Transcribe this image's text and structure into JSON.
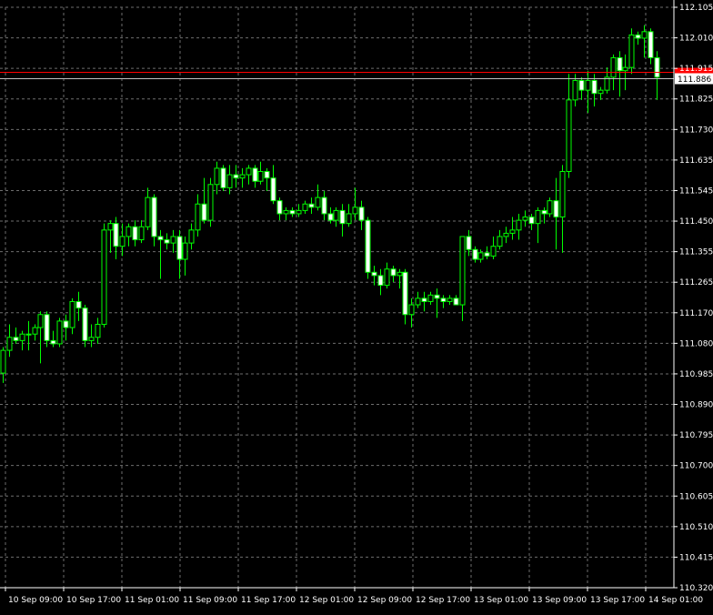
{
  "chart_data": {
    "type": "candlestick",
    "title": "",
    "xlabel": "",
    "ylabel": "",
    "ylim": [
      110.32,
      112.105
    ],
    "y_ticks": [
      "112.105",
      "112.010",
      "111.915",
      "111.825",
      "111.730",
      "111.635",
      "111.545",
      "111.450",
      "111.355",
      "111.265",
      "111.170",
      "111.080",
      "110.985",
      "110.890",
      "110.795",
      "110.700",
      "110.605",
      "110.510",
      "110.415",
      "110.320"
    ],
    "x_ticks": [
      "10 Sep 09:00",
      "10 Sep 17:00",
      "11 Sep 01:00",
      "11 Sep 09:00",
      "11 Sep 17:00",
      "12 Sep 01:00",
      "12 Sep 09:00",
      "12 Sep 17:00",
      "13 Sep 01:00",
      "13 Sep 09:00",
      "13 Sep 17:00",
      "14 Sep 01:00"
    ],
    "grid": true,
    "colors": {
      "background": "#000000",
      "grid": "#6e6e6e",
      "bull_body": "#000000",
      "bear_body": "#ffffff",
      "wick": "#00ff00",
      "axis": "#ffffff",
      "bid_line": "#ff0000",
      "ask_line": "#c0c0c0"
    },
    "bid_price": 111.905,
    "ask_price": 111.886,
    "bid_label": "",
    "ask_label": "111.886",
    "candles": [
      {
        "o": 110.98,
        "h": 111.06,
        "l": 110.95,
        "c": 111.05
      },
      {
        "o": 111.05,
        "h": 111.13,
        "l": 111.03,
        "c": 111.09
      },
      {
        "o": 111.09,
        "h": 111.12,
        "l": 111.07,
        "c": 111.08
      },
      {
        "o": 111.08,
        "h": 111.11,
        "l": 111.05,
        "c": 111.1
      },
      {
        "o": 111.1,
        "h": 111.14,
        "l": 111.05,
        "c": 111.1
      },
      {
        "o": 111.1,
        "h": 111.13,
        "l": 111.08,
        "c": 111.12
      },
      {
        "o": 111.12,
        "h": 111.17,
        "l": 111.01,
        "c": 111.16
      },
      {
        "o": 111.16,
        "h": 111.17,
        "l": 111.06,
        "c": 111.08
      },
      {
        "o": 111.08,
        "h": 111.11,
        "l": 111.06,
        "c": 111.07
      },
      {
        "o": 111.07,
        "h": 111.15,
        "l": 111.06,
        "c": 111.14
      },
      {
        "o": 111.14,
        "h": 111.16,
        "l": 111.08,
        "c": 111.12
      },
      {
        "o": 111.12,
        "h": 111.21,
        "l": 111.1,
        "c": 111.2
      },
      {
        "o": 111.2,
        "h": 111.23,
        "l": 111.14,
        "c": 111.18
      },
      {
        "o": 111.18,
        "h": 111.19,
        "l": 111.06,
        "c": 111.08
      },
      {
        "o": 111.08,
        "h": 111.13,
        "l": 111.06,
        "c": 111.09
      },
      {
        "o": 111.09,
        "h": 111.15,
        "l": 111.07,
        "c": 111.13
      },
      {
        "o": 111.13,
        "h": 111.44,
        "l": 111.12,
        "c": 111.42
      },
      {
        "o": 111.42,
        "h": 111.45,
        "l": 111.35,
        "c": 111.44
      },
      {
        "o": 111.44,
        "h": 111.46,
        "l": 111.33,
        "c": 111.37
      },
      {
        "o": 111.37,
        "h": 111.44,
        "l": 111.34,
        "c": 111.4
      },
      {
        "o": 111.4,
        "h": 111.44,
        "l": 111.37,
        "c": 111.43
      },
      {
        "o": 111.43,
        "h": 111.45,
        "l": 111.37,
        "c": 111.39
      },
      {
        "o": 111.39,
        "h": 111.45,
        "l": 111.38,
        "c": 111.43
      },
      {
        "o": 111.43,
        "h": 111.55,
        "l": 111.42,
        "c": 111.52
      },
      {
        "o": 111.52,
        "h": 111.53,
        "l": 111.37,
        "c": 111.4
      },
      {
        "o": 111.4,
        "h": 111.42,
        "l": 111.27,
        "c": 111.39
      },
      {
        "o": 111.39,
        "h": 111.41,
        "l": 111.36,
        "c": 111.38
      },
      {
        "o": 111.38,
        "h": 111.42,
        "l": 111.35,
        "c": 111.4
      },
      {
        "o": 111.4,
        "h": 111.42,
        "l": 111.27,
        "c": 111.33
      },
      {
        "o": 111.33,
        "h": 111.4,
        "l": 111.28,
        "c": 111.38
      },
      {
        "o": 111.38,
        "h": 111.44,
        "l": 111.36,
        "c": 111.42
      },
      {
        "o": 111.42,
        "h": 111.53,
        "l": 111.4,
        "c": 111.5
      },
      {
        "o": 111.5,
        "h": 111.58,
        "l": 111.44,
        "c": 111.45
      },
      {
        "o": 111.45,
        "h": 111.58,
        "l": 111.43,
        "c": 111.56
      },
      {
        "o": 111.56,
        "h": 111.63,
        "l": 111.53,
        "c": 111.61
      },
      {
        "o": 111.61,
        "h": 111.62,
        "l": 111.54,
        "c": 111.55
      },
      {
        "o": 111.55,
        "h": 111.62,
        "l": 111.53,
        "c": 111.59
      },
      {
        "o": 111.59,
        "h": 111.62,
        "l": 111.55,
        "c": 111.58
      },
      {
        "o": 111.58,
        "h": 111.61,
        "l": 111.55,
        "c": 111.59
      },
      {
        "o": 111.59,
        "h": 111.62,
        "l": 111.56,
        "c": 111.61
      },
      {
        "o": 111.61,
        "h": 111.62,
        "l": 111.55,
        "c": 111.57
      },
      {
        "o": 111.57,
        "h": 111.63,
        "l": 111.56,
        "c": 111.6
      },
      {
        "o": 111.6,
        "h": 111.61,
        "l": 111.54,
        "c": 111.58
      },
      {
        "o": 111.58,
        "h": 111.62,
        "l": 111.5,
        "c": 111.51
      },
      {
        "o": 111.51,
        "h": 111.52,
        "l": 111.45,
        "c": 111.47
      },
      {
        "o": 111.47,
        "h": 111.49,
        "l": 111.45,
        "c": 111.48
      },
      {
        "o": 111.48,
        "h": 111.49,
        "l": 111.46,
        "c": 111.47
      },
      {
        "o": 111.47,
        "h": 111.5,
        "l": 111.46,
        "c": 111.48
      },
      {
        "o": 111.48,
        "h": 111.51,
        "l": 111.47,
        "c": 111.5
      },
      {
        "o": 111.5,
        "h": 111.52,
        "l": 111.47,
        "c": 111.49
      },
      {
        "o": 111.49,
        "h": 111.56,
        "l": 111.48,
        "c": 111.52
      },
      {
        "o": 111.52,
        "h": 111.54,
        "l": 111.45,
        "c": 111.47
      },
      {
        "o": 111.47,
        "h": 111.49,
        "l": 111.44,
        "c": 111.45
      },
      {
        "o": 111.45,
        "h": 111.49,
        "l": 111.43,
        "c": 111.48
      },
      {
        "o": 111.48,
        "h": 111.5,
        "l": 111.4,
        "c": 111.44
      },
      {
        "o": 111.44,
        "h": 111.5,
        "l": 111.43,
        "c": 111.47
      },
      {
        "o": 111.47,
        "h": 111.55,
        "l": 111.45,
        "c": 111.49
      },
      {
        "o": 111.49,
        "h": 111.51,
        "l": 111.42,
        "c": 111.45
      },
      {
        "o": 111.45,
        "h": 111.46,
        "l": 111.27,
        "c": 111.29
      },
      {
        "o": 111.29,
        "h": 111.31,
        "l": 111.25,
        "c": 111.28
      },
      {
        "o": 111.28,
        "h": 111.3,
        "l": 111.22,
        "c": 111.25
      },
      {
        "o": 111.25,
        "h": 111.32,
        "l": 111.24,
        "c": 111.3
      },
      {
        "o": 111.3,
        "h": 111.31,
        "l": 111.26,
        "c": 111.28
      },
      {
        "o": 111.28,
        "h": 111.3,
        "l": 111.24,
        "c": 111.29
      },
      {
        "o": 111.29,
        "h": 111.3,
        "l": 111.13,
        "c": 111.16
      },
      {
        "o": 111.16,
        "h": 111.21,
        "l": 111.12,
        "c": 111.19
      },
      {
        "o": 111.19,
        "h": 111.23,
        "l": 111.18,
        "c": 111.21
      },
      {
        "o": 111.21,
        "h": 111.23,
        "l": 111.17,
        "c": 111.2
      },
      {
        "o": 111.2,
        "h": 111.23,
        "l": 111.19,
        "c": 111.22
      },
      {
        "o": 111.22,
        "h": 111.24,
        "l": 111.15,
        "c": 111.21
      },
      {
        "o": 111.21,
        "h": 111.22,
        "l": 111.18,
        "c": 111.2
      },
      {
        "o": 111.2,
        "h": 111.22,
        "l": 111.19,
        "c": 111.21
      },
      {
        "o": 111.21,
        "h": 111.22,
        "l": 111.19,
        "c": 111.19
      },
      {
        "o": 111.19,
        "h": 111.24,
        "l": 111.14,
        "c": 111.4
      },
      {
        "o": 111.4,
        "h": 111.42,
        "l": 111.34,
        "c": 111.36
      },
      {
        "o": 111.36,
        "h": 111.37,
        "l": 111.32,
        "c": 111.33
      },
      {
        "o": 111.33,
        "h": 111.36,
        "l": 111.32,
        "c": 111.35
      },
      {
        "o": 111.35,
        "h": 111.37,
        "l": 111.33,
        "c": 111.34
      },
      {
        "o": 111.34,
        "h": 111.4,
        "l": 111.33,
        "c": 111.37
      },
      {
        "o": 111.37,
        "h": 111.42,
        "l": 111.36,
        "c": 111.4
      },
      {
        "o": 111.4,
        "h": 111.43,
        "l": 111.38,
        "c": 111.41
      },
      {
        "o": 111.41,
        "h": 111.46,
        "l": 111.39,
        "c": 111.42
      },
      {
        "o": 111.42,
        "h": 111.47,
        "l": 111.39,
        "c": 111.45
      },
      {
        "o": 111.45,
        "h": 111.48,
        "l": 111.43,
        "c": 111.46
      },
      {
        "o": 111.46,
        "h": 111.47,
        "l": 111.42,
        "c": 111.44
      },
      {
        "o": 111.44,
        "h": 111.49,
        "l": 111.38,
        "c": 111.48
      },
      {
        "o": 111.48,
        "h": 111.49,
        "l": 111.44,
        "c": 111.47
      },
      {
        "o": 111.47,
        "h": 111.52,
        "l": 111.46,
        "c": 111.51
      },
      {
        "o": 111.51,
        "h": 111.58,
        "l": 111.36,
        "c": 111.46
      },
      {
        "o": 111.46,
        "h": 111.62,
        "l": 111.35,
        "c": 111.6
      },
      {
        "o": 111.6,
        "h": 111.9,
        "l": 111.58,
        "c": 111.82
      },
      {
        "o": 111.82,
        "h": 111.9,
        "l": 111.8,
        "c": 111.88
      },
      {
        "o": 111.88,
        "h": 111.89,
        "l": 111.82,
        "c": 111.85
      },
      {
        "o": 111.85,
        "h": 111.91,
        "l": 111.78,
        "c": 111.88
      },
      {
        "o": 111.88,
        "h": 111.9,
        "l": 111.8,
        "c": 111.84
      },
      {
        "o": 111.84,
        "h": 111.86,
        "l": 111.82,
        "c": 111.85
      },
      {
        "o": 111.85,
        "h": 111.92,
        "l": 111.84,
        "c": 111.89
      },
      {
        "o": 111.89,
        "h": 111.96,
        "l": 111.85,
        "c": 111.95
      },
      {
        "o": 111.95,
        "h": 111.97,
        "l": 111.83,
        "c": 111.91
      },
      {
        "o": 111.91,
        "h": 111.96,
        "l": 111.85,
        "c": 111.92
      },
      {
        "o": 111.92,
        "h": 112.04,
        "l": 111.9,
        "c": 112.02
      },
      {
        "o": 112.02,
        "h": 112.03,
        "l": 111.99,
        "c": 112.01
      },
      {
        "o": 112.01,
        "h": 112.05,
        "l": 111.95,
        "c": 112.03
      },
      {
        "o": 112.03,
        "h": 112.04,
        "l": 111.93,
        "c": 111.95
      },
      {
        "o": 111.95,
        "h": 111.97,
        "l": 111.82,
        "c": 111.89
      }
    ]
  }
}
